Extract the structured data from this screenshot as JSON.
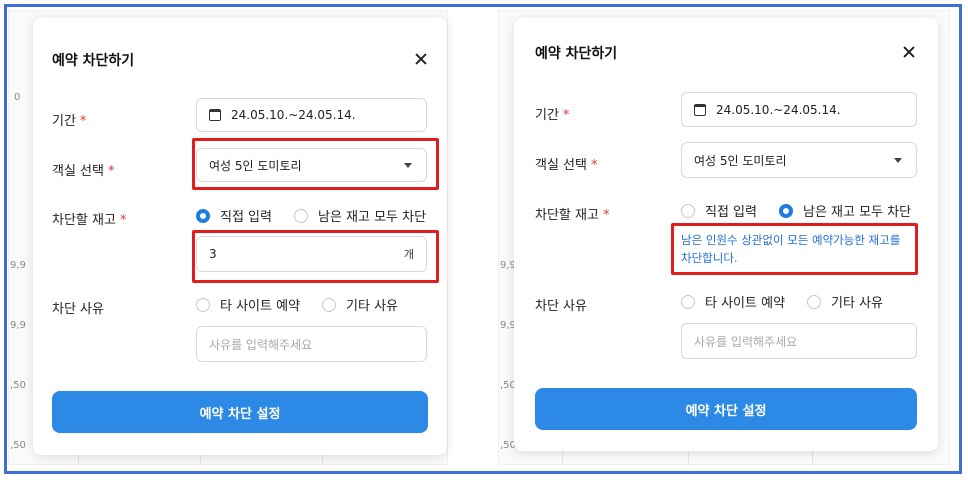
{
  "left_panel": {
    "title": "예약 차단하기",
    "period_label": "기간",
    "required_mark": "*",
    "period_value": "24.05.10.~24.05.14.",
    "room_label": "객실 선택",
    "room_value": "여성 5인 도미토리",
    "stock_label": "차단할 재고",
    "stock_options": [
      "직접 입력",
      "남은 재고 모두 차단"
    ],
    "stock_quantity": "3",
    "stock_unit": "개",
    "reason_label": "차단 사유",
    "reason_options": [
      "타 사이트 예약",
      "기타 사유"
    ],
    "reason_placeholder": "사유를 입력해주세요",
    "submit_label": "예약 차단 설정"
  },
  "right_panel": {
    "title": "예약 차단하기",
    "period_label": "기간",
    "required_mark": "*",
    "period_value": "24.05.10.~24.05.14.",
    "room_label": "객실 선택",
    "room_value": "여성 5인 도미토리",
    "stock_label": "차단할 재고",
    "stock_options": [
      "직접 입력",
      "남은 재고 모두 차단"
    ],
    "notice_line1": "남은 인원수 상관없이 모든 예약가능한 재고를",
    "notice_line2": "차단합니다.",
    "reason_label": "차단 사유",
    "reason_options": [
      "타 사이트 예약",
      "기타 사유"
    ],
    "reason_placeholder": "사유를 입력해주세요",
    "submit_label": "예약 차단 설정"
  },
  "background": {
    "left_numbers": [
      "0",
      "9,9",
      "9,9",
      ",50",
      ",50"
    ],
    "right_numbers": [
      "9,9",
      "9,9",
      ",50",
      ",50"
    ]
  },
  "colors": {
    "accent": "#2c8ae6",
    "highlight": "#e11d1d",
    "required": "#e53935",
    "notice": "#1f6fd6",
    "frame": "#3d6fd6"
  }
}
